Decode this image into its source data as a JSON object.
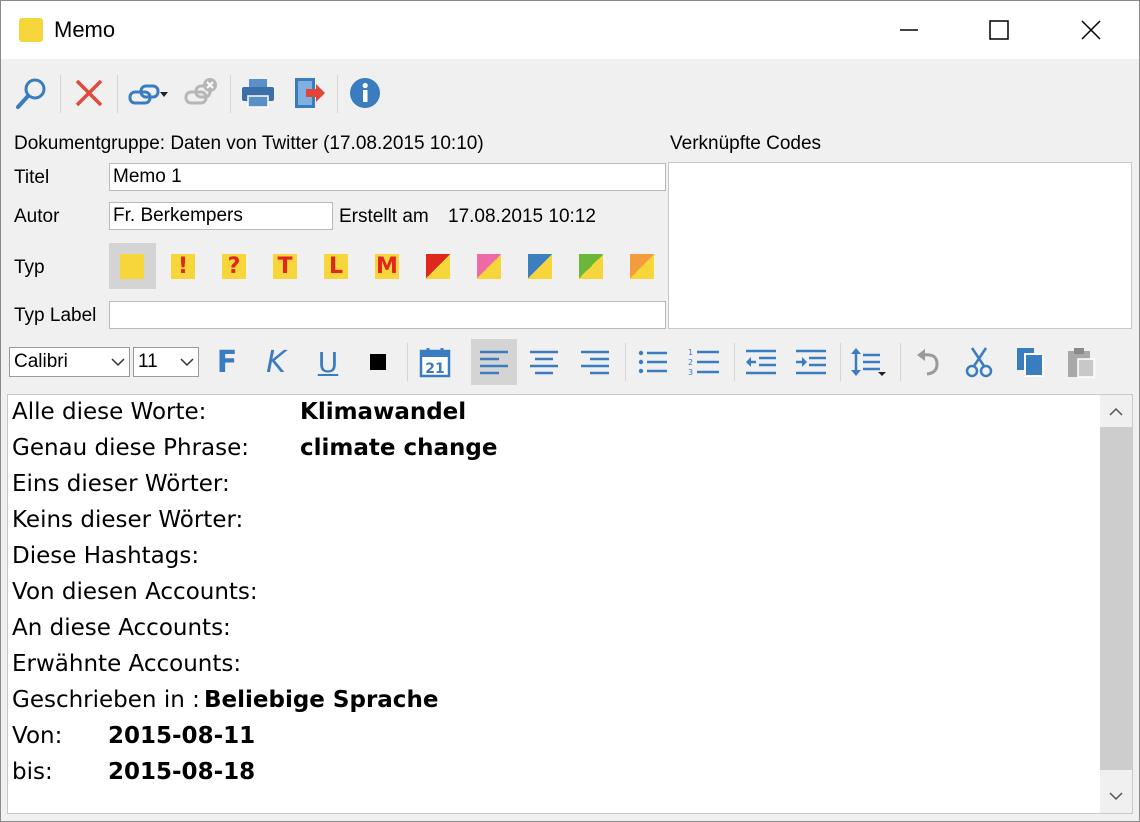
{
  "window": {
    "title": "Memo"
  },
  "header": {
    "group_label": "Dokumentgruppe: Daten von Twitter (17.08.2015 10:10)",
    "linked_codes_label": "Verknüpfte Codes"
  },
  "form": {
    "title_label": "Titel",
    "title_value": "Memo 1",
    "author_label": "Autor",
    "author_value": "Fr. Berkempers",
    "created_label": "Erstellt am",
    "created_value": "17.08.2015 10:12",
    "type_label": "Typ",
    "type_label_label": "Typ Label",
    "type_label_value": "",
    "type_icons": [
      {
        "glyph": ""
      },
      {
        "glyph": "!"
      },
      {
        "glyph": "?"
      },
      {
        "glyph": "T"
      },
      {
        "glyph": "L"
      },
      {
        "glyph": "M"
      },
      {
        "glyph": ""
      },
      {
        "glyph": ""
      },
      {
        "glyph": ""
      },
      {
        "glyph": ""
      },
      {
        "glyph": ""
      }
    ],
    "type_colors": [
      "#e0271d",
      "#ee6aa7",
      "#3c7fc1",
      "#6ab739",
      "#f39c3d"
    ]
  },
  "format_toolbar": {
    "font": "Calibri",
    "size": "11",
    "bold": "F",
    "italic": "K",
    "underline": "U",
    "calendar_day": "21",
    "list_numbers": [
      "1",
      "2",
      "3"
    ]
  },
  "editor": {
    "lines": [
      {
        "label": "Alle diese Worte:",
        "value": "Klimawandel"
      },
      {
        "label": "Genau diese Phrase:",
        "value": "climate change"
      },
      {
        "label": "Eins dieser Wörter:",
        "value": ""
      },
      {
        "label": "Keins dieser Wörter:",
        "value": ""
      },
      {
        "label": "Diese Hashtags:",
        "value": ""
      },
      {
        "label": "Von diesen Accounts:",
        "value": ""
      },
      {
        "label": "An diese Accounts:",
        "value": ""
      },
      {
        "label": "Erwähnte Accounts:",
        "value": ""
      },
      {
        "label": "Geschrieben in :",
        "value": "Beliebige Sprache"
      },
      {
        "label": "Von:",
        "value": "2015-08-11"
      },
      {
        "label": "bis:",
        "value": "2015-08-18"
      }
    ]
  }
}
